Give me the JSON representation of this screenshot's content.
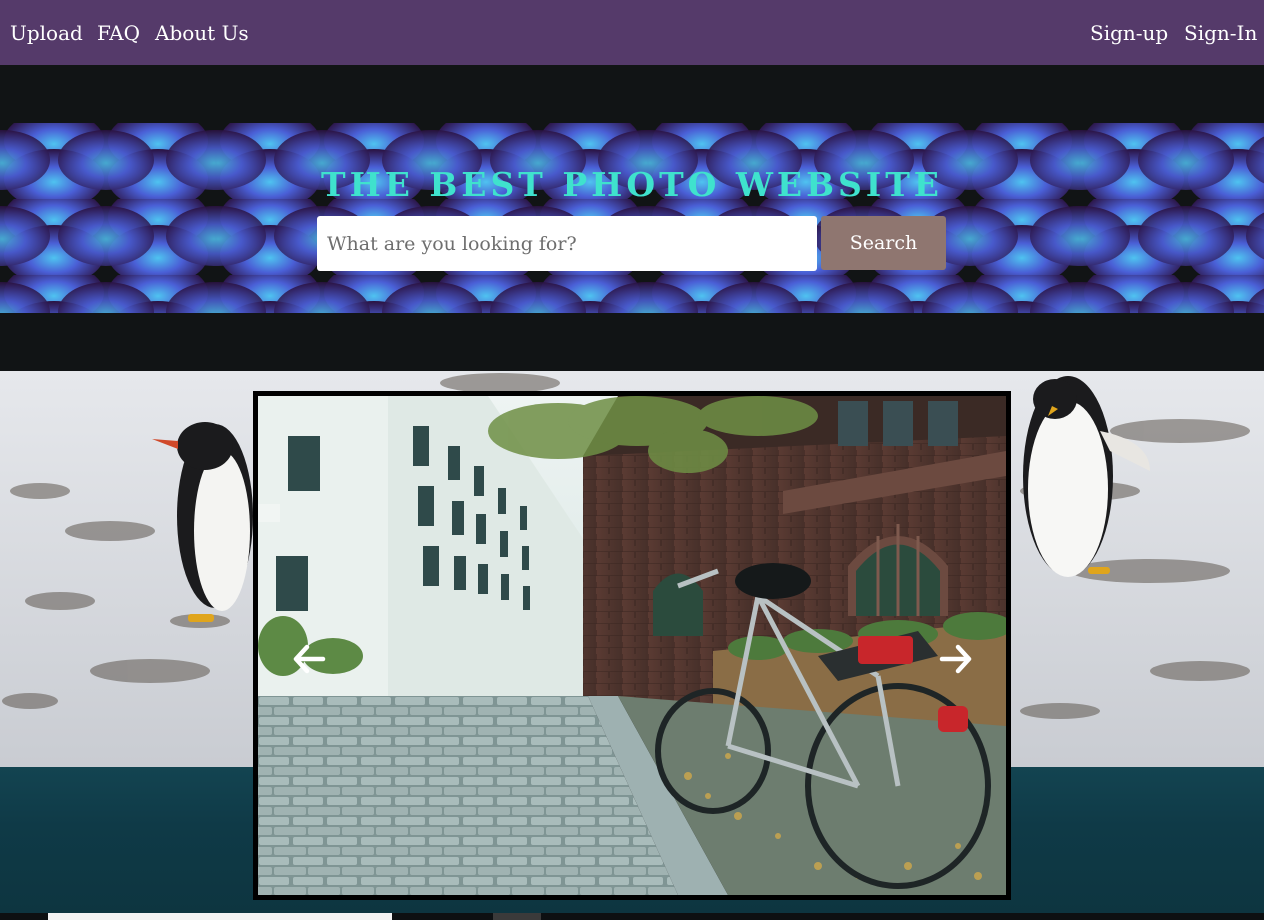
{
  "navbar": {
    "left_links": [
      "Upload",
      "FAQ",
      "About Us"
    ],
    "right_links": [
      "Sign-up",
      "Sign-In"
    ],
    "background": "#553a6a"
  },
  "hero": {
    "title": "The Best Photo Website",
    "title_color": "#3fe2cd",
    "search": {
      "placeholder": "What are you looking for?",
      "value": "",
      "button_label": "Search",
      "button_color": "#8f7670"
    }
  },
  "carousel": {
    "current_photo": "cobblestone street with parked bicycle beside brick church",
    "prev_icon": "arrow-left-icon",
    "next_icon": "arrow-right-icon"
  },
  "background_scene": {
    "upper": "penguins on snowy rocky shore",
    "lower": "teal water"
  }
}
